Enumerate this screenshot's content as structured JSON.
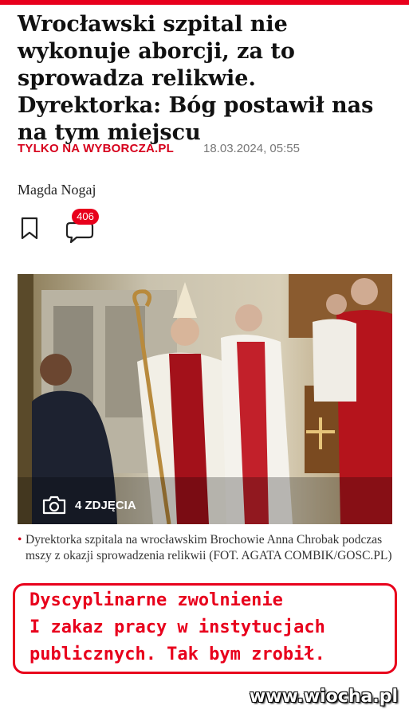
{
  "article": {
    "title": "Wrocławski szpital nie wykonuje aborcji, za to sprowadza relikwie. Dyrektorka: Bóg postawił nas na tym miejscu",
    "tag": "TYLKO NA WYBORCZA.PL",
    "date": "18.03.2024, 05:55",
    "author": "Magda Nogaj",
    "comment_count": "406"
  },
  "photo": {
    "count_label": "4 ZDJĘCIA",
    "caption": "Dyrektorka szpitala na wrocławskim Brochowie Anna Chrobak podczas mszy z okazji sprowadzenia relikwii (FOT. AGATA COMBIK/GOSC.PL)"
  },
  "overlay": {
    "line1": "Dyscyplinarne zwolnienie",
    "line2": "I zakaz pracy w instytucjach",
    "line3": "publicznych. Tak bym zrobił."
  },
  "watermark": "www.wiocha.pl",
  "colors": {
    "accent": "#e8001c",
    "tag": "#d6001c"
  }
}
